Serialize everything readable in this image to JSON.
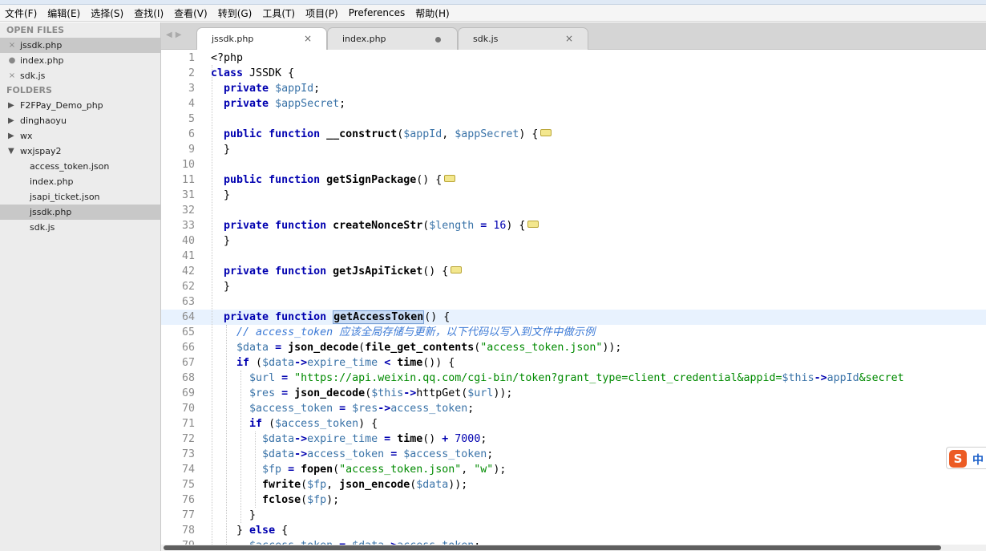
{
  "menu": [
    "文件(F)",
    "编辑(E)",
    "选择(S)",
    "查找(I)",
    "查看(V)",
    "转到(G)",
    "工具(T)",
    "项目(P)",
    "Preferences",
    "帮助(H)"
  ],
  "sidebar": {
    "open_files_header": "OPEN FILES",
    "open_files": [
      {
        "name": "jssdk.php",
        "mark": "×"
      },
      {
        "name": "index.php",
        "mark": "●"
      },
      {
        "name": "sdk.js",
        "mark": "×"
      }
    ],
    "folders_header": "FOLDERS",
    "folders": [
      "F2FPay_Demo_php",
      "dinghaoyu",
      "wx",
      "wxjspay2"
    ],
    "wxjspay2_files": [
      "access_token.json",
      "index.php",
      "jsapi_ticket.json",
      "jssdk.php",
      "sdk.js"
    ]
  },
  "tabs": [
    {
      "label": "jssdk.php",
      "state": "close"
    },
    {
      "label": "index.php",
      "state": "modified"
    },
    {
      "label": "sdk.js",
      "state": "close"
    }
  ],
  "close_glyph": "×",
  "line_numbers": [
    "1",
    "2",
    "3",
    "4",
    "5",
    "6",
    "9",
    "10",
    "11",
    "31",
    "32",
    "33",
    "40",
    "41",
    "42",
    "62",
    "63",
    "64",
    "65",
    "66",
    "67",
    "68",
    "69",
    "70",
    "71",
    "72",
    "73",
    "74",
    "75",
    "76",
    "77",
    "78",
    "79"
  ],
  "ime": {
    "logo": "S",
    "mode": "中"
  },
  "colors": {
    "keyword": "#0000b0",
    "variable": "#3a73a8",
    "string": "#008a00",
    "comment": "#3c7ad6"
  }
}
